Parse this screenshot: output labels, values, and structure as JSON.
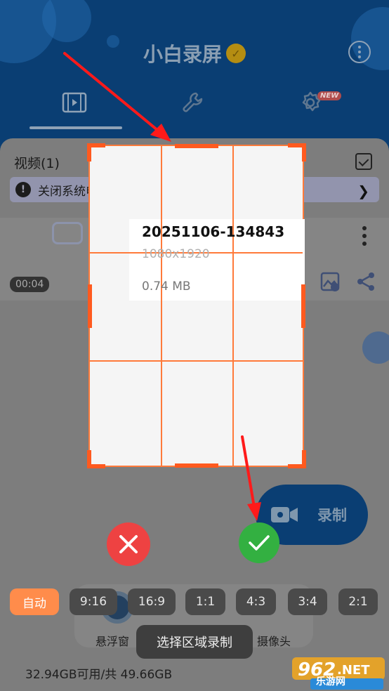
{
  "header": {
    "title": "小白录屏",
    "tabs": [
      {
        "icon": "video-library-icon",
        "active": true
      },
      {
        "icon": "tools-icon",
        "active": false
      },
      {
        "icon": "settings-icon",
        "active": false,
        "badge": "NEW"
      }
    ]
  },
  "videos": {
    "section_title": "视频(1)",
    "notice": "关闭系统电池优化，允许后台运行，避免意外停止",
    "item": {
      "name": "20251106-134843",
      "resolution": "1080x1920",
      "size": "0.74 MB",
      "duration": "00:04"
    }
  },
  "record_label": "录制",
  "toolbar": {
    "floating_label": "悬浮窗",
    "camera_label": "摄像头"
  },
  "storage": "32.94GB可用/共 49.66GB",
  "crop_mode": {
    "ratios": [
      "自动",
      "9:16",
      "16:9",
      "1:1",
      "4:3",
      "3:4",
      "2:1"
    ],
    "active_ratio": "自动",
    "toast": "选择区域录制"
  },
  "watermark": {
    "text": "乐游网",
    "brand": "962.NET"
  },
  "colors": {
    "crop_border": "#ff7a3a",
    "accent_orange": "#ff8c4b",
    "cancel_red": "#ee4242",
    "confirm_green": "#33b041",
    "header_blue": "#0a3e73"
  }
}
